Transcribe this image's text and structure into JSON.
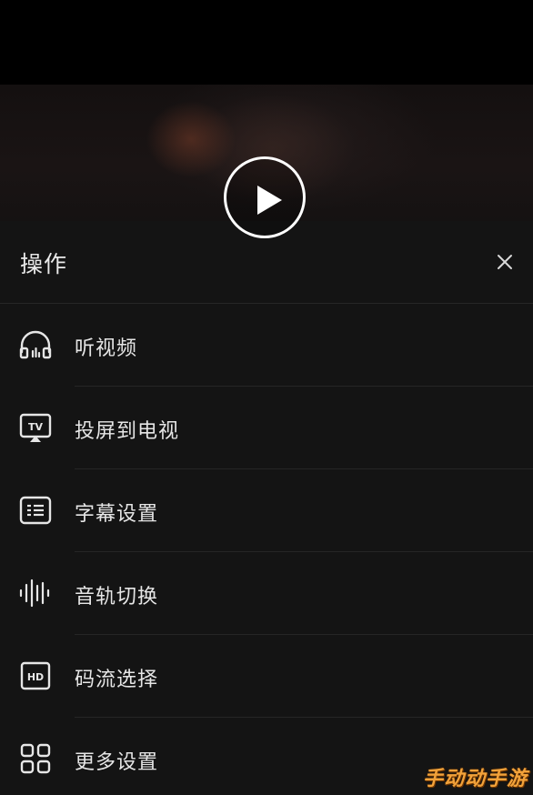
{
  "player": {
    "play_icon": "play-icon"
  },
  "sheet": {
    "title": "操作",
    "close_icon": "close-icon",
    "items": [
      {
        "label": "听视频",
        "icon": "headphones-icon"
      },
      {
        "label": "投屏到电视",
        "icon": "tv-cast-icon"
      },
      {
        "label": "字幕设置",
        "icon": "subtitles-icon"
      },
      {
        "label": "音轨切换",
        "icon": "audio-track-icon"
      },
      {
        "label": "码流选择",
        "icon": "hd-quality-icon"
      },
      {
        "label": "更多设置",
        "icon": "more-settings-grid-icon"
      }
    ]
  },
  "watermark": {
    "text": "手动动手游"
  },
  "colors": {
    "background": "#000000",
    "sheet_background": "#141414",
    "divider": "#262626",
    "text": "#e6e6e6",
    "watermark": "#f2a23a"
  }
}
